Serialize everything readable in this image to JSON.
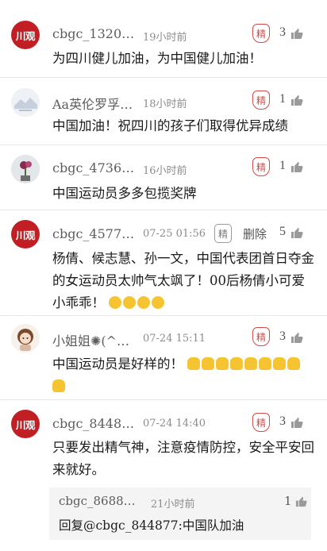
{
  "comments": [
    {
      "avatar": "chuanguan-logo",
      "avatar_text": "川观",
      "username": "cbgc_1320…",
      "time": "19小时前",
      "badge": "精",
      "likes": "3",
      "text": "为四川健儿加油，为中国健儿加油！"
    },
    {
      "avatar": "landscape-photo",
      "username": "Aa英伦罗孚…",
      "time": "18小时前",
      "badge": "精",
      "likes": "1",
      "text": "中国加油！祝四川的孩子们取得优异成绩"
    },
    {
      "avatar": "flower-photo",
      "username": "cbgc_4736…",
      "time": "16小时前",
      "badge": "精",
      "likes": "1",
      "text": "中国运动员多多包揽奖牌"
    },
    {
      "avatar": "chuanguan-logo",
      "avatar_text": "川观",
      "username": "cbgc_4577…",
      "time": "07-25 01:56",
      "badge": "精",
      "delete_label": "删除",
      "likes": "5",
      "text": "杨倩、候志慧、孙一文，中国代表团首日夺金的女运动员太帅气太飒了！00后杨倩小可爱小乖乖！",
      "emojis": [
        "rofl",
        "rofl",
        "wink-tongue",
        "wink-tongue"
      ]
    },
    {
      "avatar": "cartoon-girl",
      "username": "小姐姐✺(^…",
      "time": "07-24 15:11",
      "badge": "精",
      "likes": "3",
      "text": "中国运动员是好样的！",
      "emojis": [
        "thumbs-up",
        "thumbs-up",
        "thumbs-up",
        "thumbs-up",
        "clap",
        "clap",
        "clap",
        "clap",
        "clap"
      ]
    },
    {
      "avatar": "chuanguan-logo",
      "avatar_text": "川观",
      "username": "cbgc_8448…",
      "time": "07-24 14:40",
      "badge": "精",
      "likes": "3",
      "text": "只要发出精气神，注意疫情防控，安全平安回来就好。",
      "reply": {
        "username": "cbgc_8688…",
        "time": "21小时前",
        "likes": "1",
        "text": "回复@cbgc_844877:中国队加油"
      }
    }
  ],
  "colors": {
    "brand_red": "#c11f24",
    "badge_red": "#d34a4a",
    "text": "#1a1a1a",
    "muted": "#8c8c8c"
  }
}
